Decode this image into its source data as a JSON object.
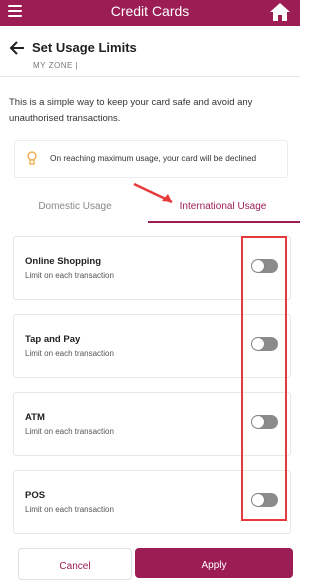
{
  "app_title": "Credit Cards",
  "page": {
    "title": "Set Usage Limits",
    "breadcrumb": "MY ZONE |"
  },
  "intro": "This is a simple way to keep your card safe and avoid any unauthorised transactions.",
  "warning": "On reaching maximum usage, your card will be declined",
  "tabs": [
    {
      "label": "Domestic Usage",
      "active": false
    },
    {
      "label": "International Usage",
      "active": true
    }
  ],
  "limits": [
    {
      "name": "Online Shopping",
      "subtitle": "Limit on each transaction",
      "enabled": false
    },
    {
      "name": "Tap and Pay",
      "subtitle": "Limit on each transaction",
      "enabled": false
    },
    {
      "name": "ATM",
      "subtitle": "Limit on each transaction",
      "enabled": false
    },
    {
      "name": "POS",
      "subtitle": "Limit on each transaction",
      "enabled": false
    }
  ],
  "buttons": {
    "cancel": "Cancel",
    "apply": "Apply"
  },
  "colors": {
    "brand": "#9c1c54",
    "annotation": "#e83a3a"
  },
  "icons": {
    "menu": "hamburger-menu-icon",
    "home": "home-icon",
    "back": "back-arrow-icon",
    "bulb": "lightbulb-icon"
  }
}
